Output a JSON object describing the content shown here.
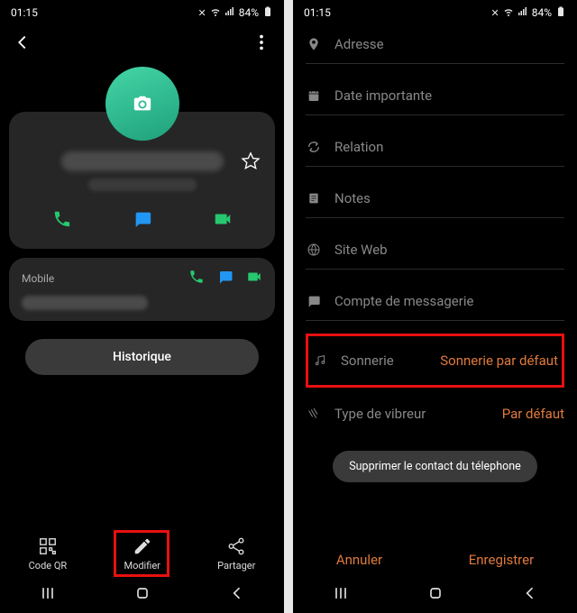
{
  "status": {
    "time": "01:15",
    "battery": "84%"
  },
  "screen1": {
    "mobile_label": "Mobile",
    "history_button": "Historique",
    "bottom": {
      "qr": "Code QR",
      "edit": "Modifier",
      "share": "Partager"
    }
  },
  "screen2": {
    "fields": {
      "address": "Adresse",
      "date": "Date importante",
      "relation": "Relation",
      "notes": "Notes",
      "website": "Site Web",
      "email": "Compte de messagerie",
      "ringtone_label": "Sonnerie",
      "ringtone_value": "Sonnerie par défaut",
      "vibration_label": "Type de vibreur",
      "vibration_value": "Par défaut"
    },
    "delete": "Supprimer le contact du télephone",
    "cancel": "Annuler",
    "save": "Enregistrer"
  }
}
